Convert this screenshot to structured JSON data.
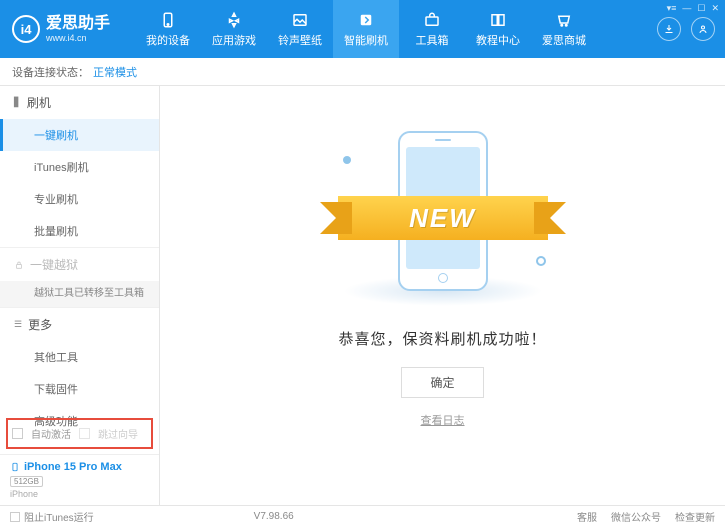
{
  "header": {
    "logo_title": "爱思助手",
    "logo_sub": "www.i4.cn",
    "tabs": [
      {
        "label": "我的设备"
      },
      {
        "label": "应用游戏"
      },
      {
        "label": "铃声壁纸"
      },
      {
        "label": "智能刷机"
      },
      {
        "label": "工具箱"
      },
      {
        "label": "教程中心"
      },
      {
        "label": "爱思商城"
      }
    ]
  },
  "status": {
    "label": "设备连接状态：",
    "mode": "正常模式"
  },
  "sidebar": {
    "flash": {
      "title": "刷机"
    },
    "items": {
      "one_key": "一键刷机",
      "itunes": "iTunes刷机",
      "pro": "专业刷机",
      "batch": "批量刷机"
    },
    "jailbreak": {
      "title": "一键越狱",
      "note": "越狱工具已转移至工具箱"
    },
    "more": {
      "title": "更多"
    },
    "more_items": {
      "other": "其他工具",
      "download": "下载固件",
      "advanced": "高级功能"
    },
    "checks": {
      "auto_activate": "自动激活",
      "skip_guide": "跳过向导"
    },
    "device": {
      "name": "iPhone 15 Pro Max",
      "storage": "512GB",
      "type": "iPhone"
    }
  },
  "main": {
    "ribbon": "NEW",
    "success": "恭喜您，保资料刷机成功啦！",
    "ok": "确定",
    "log": "查看日志"
  },
  "footer": {
    "block_itunes": "阻止iTunes运行",
    "version": "V7.98.66",
    "links": {
      "service": "客服",
      "wechat": "微信公众号",
      "update": "检查更新"
    }
  }
}
